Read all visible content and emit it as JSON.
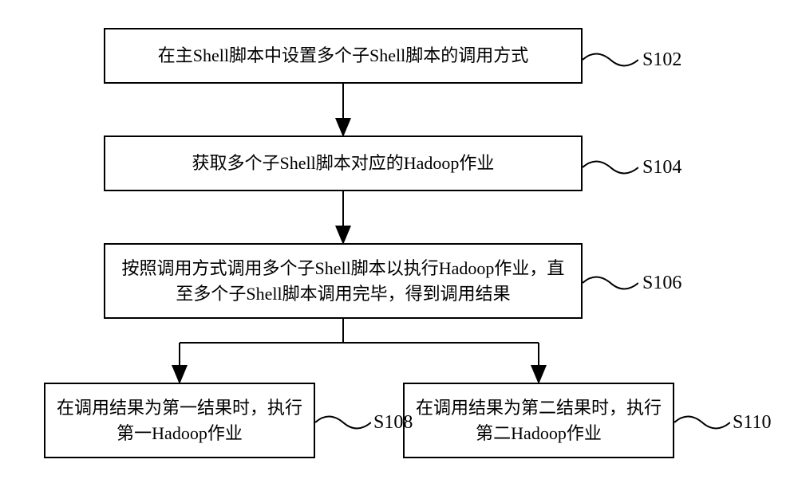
{
  "chart_data": {
    "type": "flowchart",
    "nodes": [
      {
        "id": "S102",
        "label": "在主Shell脚本中设置多个子Shell脚本的调用方式"
      },
      {
        "id": "S104",
        "label": "获取多个子Shell脚本对应的Hadoop作业"
      },
      {
        "id": "S106",
        "label": "按照调用方式调用多个子Shell脚本以执行Hadoop作业，直至多个子Shell脚本调用完毕，得到调用结果"
      },
      {
        "id": "S108",
        "label": "在调用结果为第一结果时，执行第一Hadoop作业"
      },
      {
        "id": "S110",
        "label": "在调用结果为第二结果时，执行第二Hadoop作业"
      }
    ],
    "edges": [
      {
        "from": "S102",
        "to": "S104"
      },
      {
        "from": "S104",
        "to": "S106"
      },
      {
        "from": "S106",
        "to": "S108"
      },
      {
        "from": "S106",
        "to": "S110"
      }
    ]
  },
  "boxes": {
    "s102": "在主Shell脚本中设置多个子Shell脚本的调用方式",
    "s104": "获取多个子Shell脚本对应的Hadoop作业",
    "s106": "按照调用方式调用多个子Shell脚本以执行Hadoop作业，直至多个子Shell脚本调用完毕，得到调用结果",
    "s108": "在调用结果为第一结果时，执行第一Hadoop作业",
    "s110": "在调用结果为第二结果时，执行第二Hadoop作业"
  },
  "labels": {
    "s102": "S102",
    "s104": "S104",
    "s106": "S106",
    "s108": "S108",
    "s110": "S110"
  }
}
